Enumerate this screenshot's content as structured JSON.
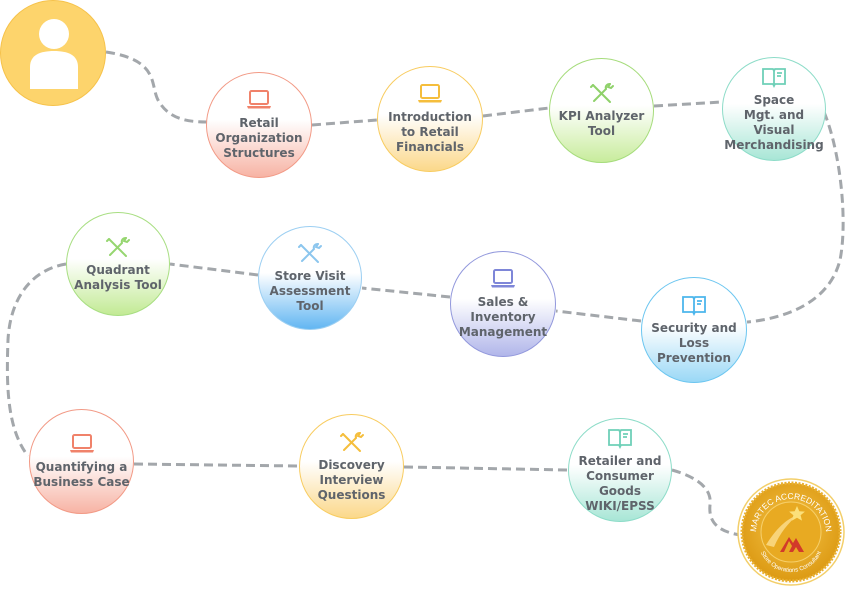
{
  "learner": {
    "icon": "user-icon"
  },
  "modules": [
    {
      "id": "retail-organization-structures",
      "label": "Retail\nOrganization\nStructures",
      "icon": "laptop-icon",
      "color": "#f0826a",
      "fill_top": "#ffffff",
      "fill_bottom": "#f7b3a4",
      "border": "#f29a86"
    },
    {
      "id": "introduction-to-retail-financials",
      "label": "Introduction\nto Retail\nFinancials",
      "icon": "laptop-icon",
      "color": "#f5be3c",
      "fill_top": "#ffffff",
      "fill_bottom": "#fbd88a",
      "border": "#f8cc60"
    },
    {
      "id": "kpi-analyzer-tool",
      "label": "KPI Analyzer\nTool",
      "icon": "tools-icon",
      "color": "#8fd16a",
      "fill_top": "#ffffff",
      "fill_bottom": "#c8ec9c",
      "border": "#a6dc7c"
    },
    {
      "id": "space-mgt-visual-merchandising",
      "label": "Space\nMgt. and Visual\nMerchandising",
      "icon": "book-icon",
      "color": "#6fd0b8",
      "fill_top": "#ffffff",
      "fill_bottom": "#a8e6d6",
      "border": "#8ddcc8"
    },
    {
      "id": "security-and-loss-prevention",
      "label": "Security and\nLoss Prevention",
      "icon": "book-icon",
      "color": "#4cb6ec",
      "fill_top": "#ffffff",
      "fill_bottom": "#9ad8f6",
      "border": "#6cc6f0"
    },
    {
      "id": "sales-and-inventory-management",
      "label": "Sales &\nInventory\nManagement",
      "icon": "laptop-icon",
      "color": "#7e86d8",
      "fill_top": "#ffffff",
      "fill_bottom": "#b1b6ea",
      "border": "#9298dc"
    },
    {
      "id": "store-visit-assessment-tool",
      "label": "Store Visit\nAssessment\nTool",
      "icon": "tools-icon",
      "color": "#8cc6ee",
      "fill_top": "#ffffff",
      "fill_bottom": "#62b6f2",
      "border": "#9ccff2"
    },
    {
      "id": "quadrant-analysis-tool",
      "label": "Quadrant\nAnalysis Tool",
      "icon": "tools-icon",
      "color": "#96d670",
      "fill_top": "#ffffff",
      "fill_bottom": "#c2ea94",
      "border": "#a8de82"
    },
    {
      "id": "quantifying-a-business-case",
      "label": "Quantifying a\nBusiness Case",
      "icon": "laptop-icon",
      "color": "#f0826a",
      "fill_top": "#ffffff",
      "fill_bottom": "#f7b3a4",
      "border": "#f29a86"
    },
    {
      "id": "discovery-interview-questions",
      "label": "Discovery\nInterview\nQuestions",
      "icon": "tools-icon",
      "color": "#f5be3c",
      "fill_top": "#ffffff",
      "fill_bottom": "#fbd88a",
      "border": "#f8cc60"
    },
    {
      "id": "retailer-consumer-goods-wiki-epss",
      "label": "Retailer and\nConsumer Goods\nWIKI/EPSS",
      "icon": "book-icon",
      "color": "#6fd0b8",
      "fill_top": "#ffffff",
      "fill_bottom": "#a8e6d6",
      "border": "#8ddcc8"
    }
  ],
  "badge": {
    "top_text": "MARTEC ACCREDITATION",
    "bottom_text": "Store Operations Consultant",
    "icon": "star-icon",
    "logo": "martec-logo",
    "gold": "#e6a820",
    "logo_color": "#d23a2a"
  },
  "path_color": "#a3a7ab"
}
